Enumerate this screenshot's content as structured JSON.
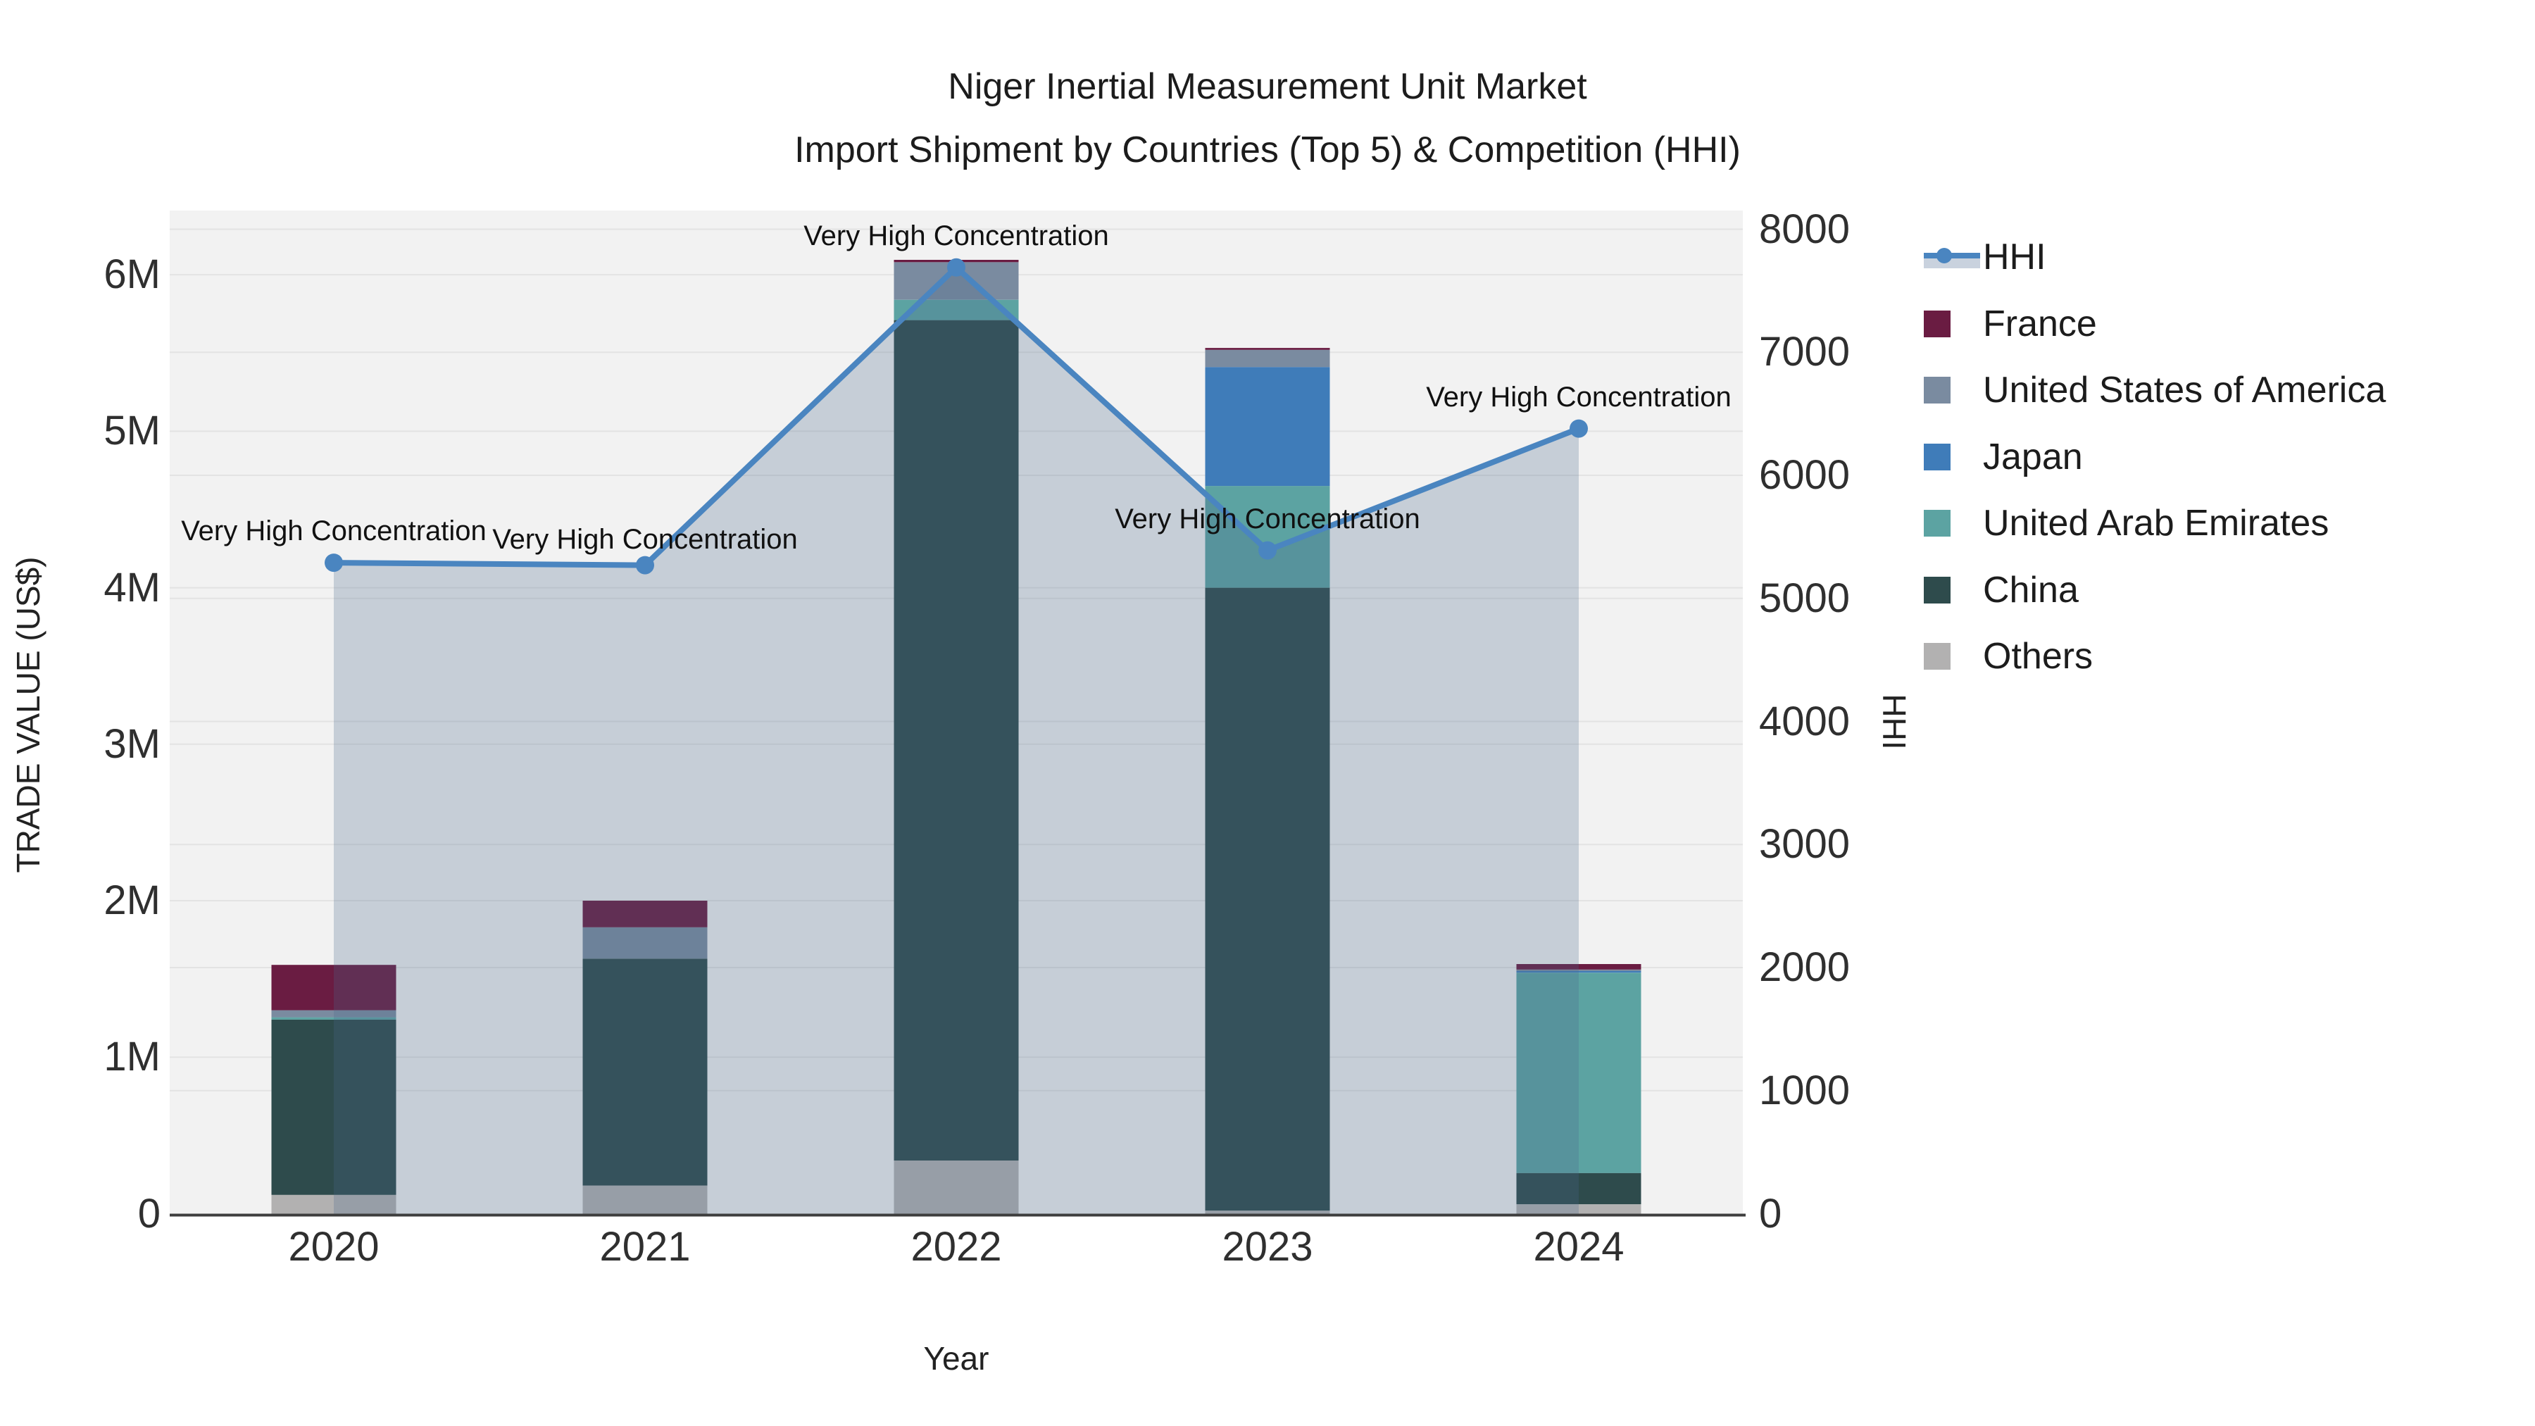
{
  "title": {
    "line1": "Niger Inertial Measurement Unit Market",
    "line2": "Import Shipment by Countries (Top 5) & Competition (HHI)"
  },
  "axes": {
    "x_title": "Year",
    "y_left_title": "TRADE VALUE (US$)",
    "y_right_title": "HHI",
    "y_left_ticks": [
      "0",
      "1M",
      "2M",
      "3M",
      "4M",
      "5M",
      "6M"
    ],
    "y_left_tick_values": [
      0,
      1000000,
      2000000,
      3000000,
      4000000,
      5000000,
      6000000
    ],
    "y_right_ticks": [
      "0",
      "1000",
      "2000",
      "3000",
      "4000",
      "5000",
      "6000",
      "7000",
      "8000"
    ],
    "y_right_tick_values": [
      0,
      1000,
      2000,
      3000,
      4000,
      5000,
      6000,
      7000,
      8000
    ]
  },
  "legend": [
    {
      "label": "HHI",
      "type": "line",
      "color": "#4A85C0",
      "fill": "#C9D2DE"
    },
    {
      "label": "France",
      "type": "swatch",
      "color": "#6A1C42"
    },
    {
      "label": "United States of America",
      "type": "swatch",
      "color": "#7A8BA0"
    },
    {
      "label": "Japan",
      "type": "swatch",
      "color": "#3F7CB9"
    },
    {
      "label": "United Arab Emirates",
      "type": "swatch",
      "color": "#5CA3A2"
    },
    {
      "label": "China",
      "type": "swatch",
      "color": "#2E4B4C"
    },
    {
      "label": "Others",
      "type": "swatch",
      "color": "#B2B1B1"
    }
  ],
  "chart_data": {
    "type": "bar",
    "subtype": "stacked-bars-with-line",
    "categories": [
      "2020",
      "2021",
      "2022",
      "2023",
      "2024"
    ],
    "bar_value_unit": "US$",
    "series": [
      {
        "name": "Others",
        "color": "#B2B1B1",
        "values": [
          120000,
          180000,
          340000,
          20000,
          60000
        ]
      },
      {
        "name": "China",
        "color": "#2E4B4C",
        "values": [
          1120000,
          1450000,
          5370000,
          3980000,
          200000
        ]
      },
      {
        "name": "United Arab Emirates",
        "color": "#5CA3A2",
        "values": [
          15000,
          0,
          130000,
          650000,
          1280000
        ]
      },
      {
        "name": "Japan",
        "color": "#3F7CB9",
        "values": [
          0,
          0,
          0,
          760000,
          10000
        ]
      },
      {
        "name": "United States of America",
        "color": "#7A8BA0",
        "values": [
          45000,
          200000,
          240000,
          110000,
          10000
        ]
      },
      {
        "name": "France",
        "color": "#6A1C42",
        "values": [
          290000,
          170000,
          15000,
          12000,
          35000
        ]
      }
    ],
    "line_series": {
      "name": "HHI",
      "color": "#4A85C0",
      "area_fill": "rgba(73,103,140,0.26)",
      "values": [
        5290,
        5270,
        7690,
        5390,
        6380
      ]
    },
    "bar_totals": [
      1590000,
      2000000,
      6095000,
      5532000,
      1595000
    ],
    "ylim_left": [
      0,
      6410000
    ],
    "ylim_right": [
      0,
      8152
    ],
    "grid": true,
    "legend_position": "right",
    "annotations": [
      {
        "text": "Very High Concentration",
        "category": "2020"
      },
      {
        "text": "Very High Concentration",
        "category": "2021"
      },
      {
        "text": "Very High Concentration",
        "category": "2022"
      },
      {
        "text": "Very High Concentration",
        "category": "2023"
      },
      {
        "text": "Very High Concentration",
        "category": "2024"
      }
    ],
    "colors": {
      "plot_background": "#F2F2F2",
      "gridline": "#E3E3E3",
      "axis_line": "#3E3E3E"
    }
  }
}
